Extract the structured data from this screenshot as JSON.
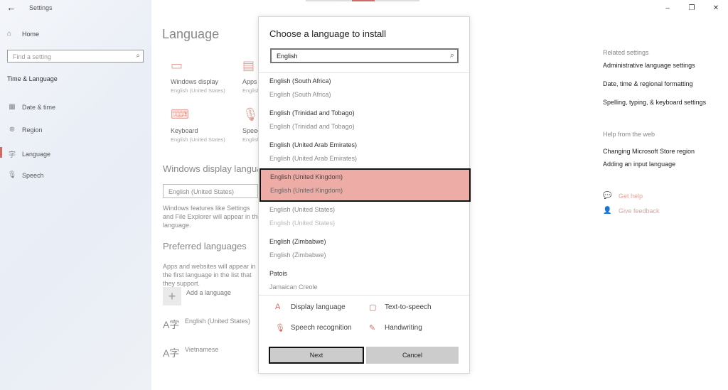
{
  "window": {
    "title": "Settings",
    "back_glyph": "←",
    "controls": [
      "–",
      "❐",
      "✕"
    ]
  },
  "sidebar": {
    "home_label": "Home",
    "search_placeholder": "Find a setting",
    "section": "Time & Language",
    "items": [
      {
        "label": "Date & time",
        "icon": "calendar-icon"
      },
      {
        "label": "Region",
        "icon": "globe-icon"
      },
      {
        "label": "Language",
        "icon": "language-icon",
        "active": true
      },
      {
        "label": "Speech",
        "icon": "microphone-icon"
      }
    ]
  },
  "main": {
    "title": "Language",
    "tiles": [
      {
        "title": "Windows display",
        "sub": "English (United States)",
        "icon": "monitor-icon"
      },
      {
        "title": "Apps",
        "sub": "English",
        "icon": "app-window-icon"
      },
      {
        "title": "Keyboard",
        "sub": "English (United States)",
        "icon": "keyboard-icon"
      },
      {
        "title": "Speech",
        "sub": "English",
        "icon": "microphone-icon"
      }
    ],
    "display_heading": "Windows display language",
    "display_value": "English (United States)",
    "display_desc": "Windows features like Settings and File Explorer will appear in this language.",
    "preferred_heading": "Preferred languages",
    "preferred_desc": "Apps and websites will appear in the first language in the list that they support.",
    "add_label": "Add a language",
    "languages": [
      "English (United States)",
      "Vietnamese"
    ]
  },
  "related": {
    "heading": "Related settings",
    "links": [
      "Administrative language settings",
      "Date, time & regional formatting",
      "Spelling, typing, & keyboard settings"
    ]
  },
  "web_help": {
    "heading": "Help from the web",
    "links": [
      "Changing Microsoft Store region",
      "Adding an input language"
    ]
  },
  "help": {
    "get_help": "Get help",
    "feedback": "Give feedback"
  },
  "dialog": {
    "title": "Choose a language to install",
    "search_value": "English",
    "items": [
      {
        "name": "English (South Africa)",
        "native": "English (South Africa)"
      },
      {
        "name": "English (Trinidad and Tobago)",
        "native": "English (Trinidad and Tobago)"
      },
      {
        "name": "English (United Arab Emirates)",
        "native": "English (United Arab Emirates)"
      },
      {
        "name": "English (United Kingdom)",
        "native": "English (United Kingdom)",
        "selected": true
      },
      {
        "name": "English (United States)",
        "native": "English (United States)",
        "installed": true
      },
      {
        "name": "English (Zimbabwe)",
        "native": "English (Zimbabwe)"
      },
      {
        "name": "Patois",
        "native": "Jamaican Creole"
      }
    ],
    "features": {
      "display": "Display language",
      "tts": "Text-to-speech",
      "speech": "Speech recognition",
      "handwriting": "Handwriting"
    },
    "next_label": "Next",
    "cancel_label": "Cancel"
  }
}
